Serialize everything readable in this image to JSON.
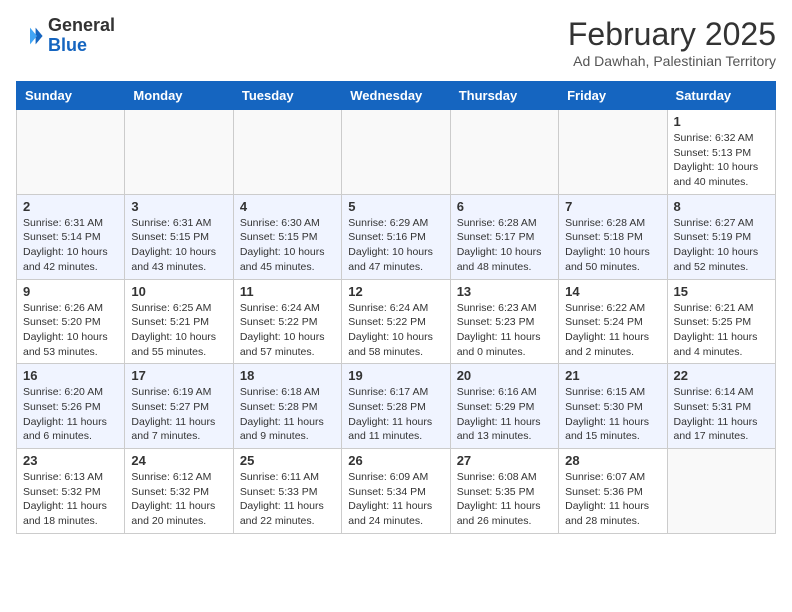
{
  "header": {
    "logo_general": "General",
    "logo_blue": "Blue",
    "month_year": "February 2025",
    "location": "Ad Dawhah, Palestinian Territory"
  },
  "days_of_week": [
    "Sunday",
    "Monday",
    "Tuesday",
    "Wednesday",
    "Thursday",
    "Friday",
    "Saturday"
  ],
  "weeks": [
    [
      {
        "day": "",
        "info": ""
      },
      {
        "day": "",
        "info": ""
      },
      {
        "day": "",
        "info": ""
      },
      {
        "day": "",
        "info": ""
      },
      {
        "day": "",
        "info": ""
      },
      {
        "day": "",
        "info": ""
      },
      {
        "day": "1",
        "info": "Sunrise: 6:32 AM\nSunset: 5:13 PM\nDaylight: 10 hours and 40 minutes."
      }
    ],
    [
      {
        "day": "2",
        "info": "Sunrise: 6:31 AM\nSunset: 5:14 PM\nDaylight: 10 hours and 42 minutes."
      },
      {
        "day": "3",
        "info": "Sunrise: 6:31 AM\nSunset: 5:15 PM\nDaylight: 10 hours and 43 minutes."
      },
      {
        "day": "4",
        "info": "Sunrise: 6:30 AM\nSunset: 5:15 PM\nDaylight: 10 hours and 45 minutes."
      },
      {
        "day": "5",
        "info": "Sunrise: 6:29 AM\nSunset: 5:16 PM\nDaylight: 10 hours and 47 minutes."
      },
      {
        "day": "6",
        "info": "Sunrise: 6:28 AM\nSunset: 5:17 PM\nDaylight: 10 hours and 48 minutes."
      },
      {
        "day": "7",
        "info": "Sunrise: 6:28 AM\nSunset: 5:18 PM\nDaylight: 10 hours and 50 minutes."
      },
      {
        "day": "8",
        "info": "Sunrise: 6:27 AM\nSunset: 5:19 PM\nDaylight: 10 hours and 52 minutes."
      }
    ],
    [
      {
        "day": "9",
        "info": "Sunrise: 6:26 AM\nSunset: 5:20 PM\nDaylight: 10 hours and 53 minutes."
      },
      {
        "day": "10",
        "info": "Sunrise: 6:25 AM\nSunset: 5:21 PM\nDaylight: 10 hours and 55 minutes."
      },
      {
        "day": "11",
        "info": "Sunrise: 6:24 AM\nSunset: 5:22 PM\nDaylight: 10 hours and 57 minutes."
      },
      {
        "day": "12",
        "info": "Sunrise: 6:24 AM\nSunset: 5:22 PM\nDaylight: 10 hours and 58 minutes."
      },
      {
        "day": "13",
        "info": "Sunrise: 6:23 AM\nSunset: 5:23 PM\nDaylight: 11 hours and 0 minutes."
      },
      {
        "day": "14",
        "info": "Sunrise: 6:22 AM\nSunset: 5:24 PM\nDaylight: 11 hours and 2 minutes."
      },
      {
        "day": "15",
        "info": "Sunrise: 6:21 AM\nSunset: 5:25 PM\nDaylight: 11 hours and 4 minutes."
      }
    ],
    [
      {
        "day": "16",
        "info": "Sunrise: 6:20 AM\nSunset: 5:26 PM\nDaylight: 11 hours and 6 minutes."
      },
      {
        "day": "17",
        "info": "Sunrise: 6:19 AM\nSunset: 5:27 PM\nDaylight: 11 hours and 7 minutes."
      },
      {
        "day": "18",
        "info": "Sunrise: 6:18 AM\nSunset: 5:28 PM\nDaylight: 11 hours and 9 minutes."
      },
      {
        "day": "19",
        "info": "Sunrise: 6:17 AM\nSunset: 5:28 PM\nDaylight: 11 hours and 11 minutes."
      },
      {
        "day": "20",
        "info": "Sunrise: 6:16 AM\nSunset: 5:29 PM\nDaylight: 11 hours and 13 minutes."
      },
      {
        "day": "21",
        "info": "Sunrise: 6:15 AM\nSunset: 5:30 PM\nDaylight: 11 hours and 15 minutes."
      },
      {
        "day": "22",
        "info": "Sunrise: 6:14 AM\nSunset: 5:31 PM\nDaylight: 11 hours and 17 minutes."
      }
    ],
    [
      {
        "day": "23",
        "info": "Sunrise: 6:13 AM\nSunset: 5:32 PM\nDaylight: 11 hours and 18 minutes."
      },
      {
        "day": "24",
        "info": "Sunrise: 6:12 AM\nSunset: 5:32 PM\nDaylight: 11 hours and 20 minutes."
      },
      {
        "day": "25",
        "info": "Sunrise: 6:11 AM\nSunset: 5:33 PM\nDaylight: 11 hours and 22 minutes."
      },
      {
        "day": "26",
        "info": "Sunrise: 6:09 AM\nSunset: 5:34 PM\nDaylight: 11 hours and 24 minutes."
      },
      {
        "day": "27",
        "info": "Sunrise: 6:08 AM\nSunset: 5:35 PM\nDaylight: 11 hours and 26 minutes."
      },
      {
        "day": "28",
        "info": "Sunrise: 6:07 AM\nSunset: 5:36 PM\nDaylight: 11 hours and 28 minutes."
      },
      {
        "day": "",
        "info": ""
      }
    ]
  ]
}
